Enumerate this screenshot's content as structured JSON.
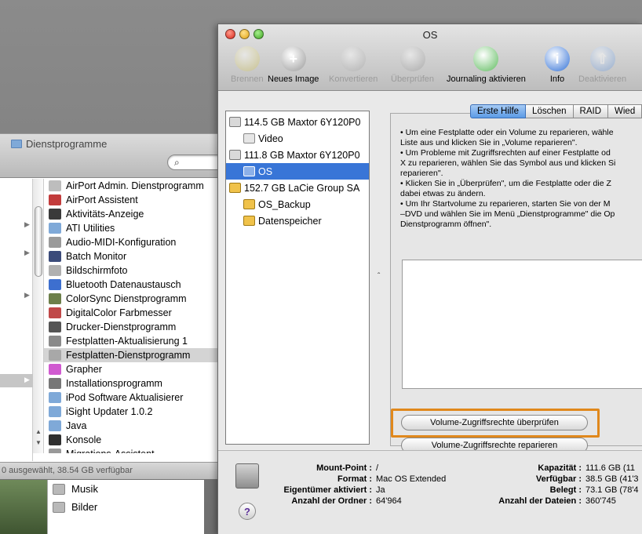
{
  "finder": {
    "title": "Dienstprogramme",
    "items": [
      {
        "label": "AirPort Admin. Dienstprogramm",
        "color": "#bdbdbd"
      },
      {
        "label": "AirPort Assistent",
        "color": "#c23b3b"
      },
      {
        "label": "Aktivitäts-Anzeige",
        "color": "#3a3a3a"
      },
      {
        "label": "ATI Utilities",
        "color": "#7fa9d8"
      },
      {
        "label": "Audio-MIDI-Konfiguration",
        "color": "#9a9a9a"
      },
      {
        "label": "Batch Monitor",
        "color": "#3b4b7a"
      },
      {
        "label": "Bildschirmfoto",
        "color": "#b0b0b0"
      },
      {
        "label": "Bluetooth Datenaustausch",
        "color": "#3d6fcf"
      },
      {
        "label": "ColorSync Dienstprogramm",
        "color": "#6c7f4a"
      },
      {
        "label": "DigitalColor Farbmesser",
        "color": "#c04848"
      },
      {
        "label": "Drucker-Dienstprogramm",
        "color": "#555555"
      },
      {
        "label": "Festplatten-Aktualisierung 1",
        "color": "#8a8a8a"
      },
      {
        "label": "Festplatten-Dienstprogramm",
        "color": "#a8a8a8"
      },
      {
        "label": "Grapher",
        "color": "#d05ad0"
      },
      {
        "label": "Installationsprogramm",
        "color": "#777777"
      },
      {
        "label": "iPod Software Aktualisierer",
        "color": "#7fa9d8"
      },
      {
        "label": "iSight Updater 1.0.2",
        "color": "#7fa9d8"
      },
      {
        "label": "Java",
        "color": "#7fa9d8"
      },
      {
        "label": "Konsole",
        "color": "#2f2f2f"
      },
      {
        "label": "Migrations-Assistent",
        "color": "#999999"
      }
    ],
    "selected_index": 12,
    "status": "0 ausgewählt, 38.54 GB verfügbar"
  },
  "finder2": {
    "items": [
      "Musik",
      "Bilder"
    ]
  },
  "window": {
    "title": "OS"
  },
  "toolbar": [
    {
      "label": "Brennen",
      "icon": "burn-icon",
      "enabled": false,
      "color": "#c8b94a"
    },
    {
      "label": "Neues Image",
      "icon": "new-image-icon",
      "enabled": true,
      "color": "#9a9a9a"
    },
    {
      "label": "Konvertieren",
      "icon": "convert-icon",
      "enabled": false,
      "color": "#9a9a9a"
    },
    {
      "label": "Überprüfen",
      "icon": "microscope-icon",
      "enabled": false,
      "color": "#8a8a8a"
    },
    {
      "label": "Journaling aktivieren",
      "icon": "journaling-icon",
      "enabled": true,
      "color": "#5dbb5d"
    },
    {
      "label": "Info",
      "icon": "info-icon",
      "enabled": true,
      "color": "#2f6fd6"
    },
    {
      "label": "Deaktivieren",
      "icon": "unmount-icon",
      "enabled": false,
      "color": "#5d8fd6"
    }
  ],
  "disks": [
    {
      "label": "114.5 GB Maxtor 6Y120P0",
      "level": 0,
      "type": "disk"
    },
    {
      "label": "Video",
      "level": 1,
      "type": "volume"
    },
    {
      "label": "111.8 GB Maxtor 6Y120P0",
      "level": 0,
      "type": "disk"
    },
    {
      "label": "OS",
      "level": 1,
      "type": "volume",
      "selected": true
    },
    {
      "label": "152.7 GB LaCie Group SA",
      "level": 0,
      "type": "external"
    },
    {
      "label": "OS_Backup",
      "level": 1,
      "type": "external-volume"
    },
    {
      "label": "Datenspeicher",
      "level": 1,
      "type": "external-volume"
    }
  ],
  "tabs": [
    "Erste Hilfe",
    "Löschen",
    "RAID",
    "Wied"
  ],
  "active_tab": 0,
  "help_lines": [
    "• Um eine Festplatte oder ein Volume zu reparieren, wähle",
    "Liste aus und klicken Sie in „Volume reparieren\".",
    "• Um Probleme mit Zugriffsrechten auf einer Festplatte od",
    "X zu reparieren, wählen Sie das Symbol aus und klicken Si",
    "reparieren\".",
    "• Klicken Sie in „Überprüfen\", um die Festplatte oder die Z",
    "dabei etwas zu ändern.",
    "• Um Ihr Startvolume zu reparieren, starten Sie von der M",
    "–DVD und wählen Sie im Menü „Dienstprogramme\" die Op",
    "Dienstprogramm öffnen\"."
  ],
  "buttons": {
    "verify_permissions": "Volume-Zugriffsrechte überprüfen",
    "repair_permissions": "Volume-Zugriffsrechte reparieren"
  },
  "highlight_color": "#e0881c",
  "info_left": [
    {
      "label": "Mount-Point :",
      "value": "/"
    },
    {
      "label": "Format :",
      "value": "Mac OS Extended"
    },
    {
      "label": "Eigentümer aktiviert :",
      "value": "Ja"
    },
    {
      "label": "Anzahl der Ordner :",
      "value": "64'964"
    }
  ],
  "info_right": [
    {
      "label": "Kapazität :",
      "value": "111.6 GB (11"
    },
    {
      "label": "Verfügbar :",
      "value": "38.5 GB (41'3"
    },
    {
      "label": "Belegt :",
      "value": "73.1 GB (78'4"
    },
    {
      "label": "Anzahl der Dateien :",
      "value": "360'745"
    }
  ]
}
